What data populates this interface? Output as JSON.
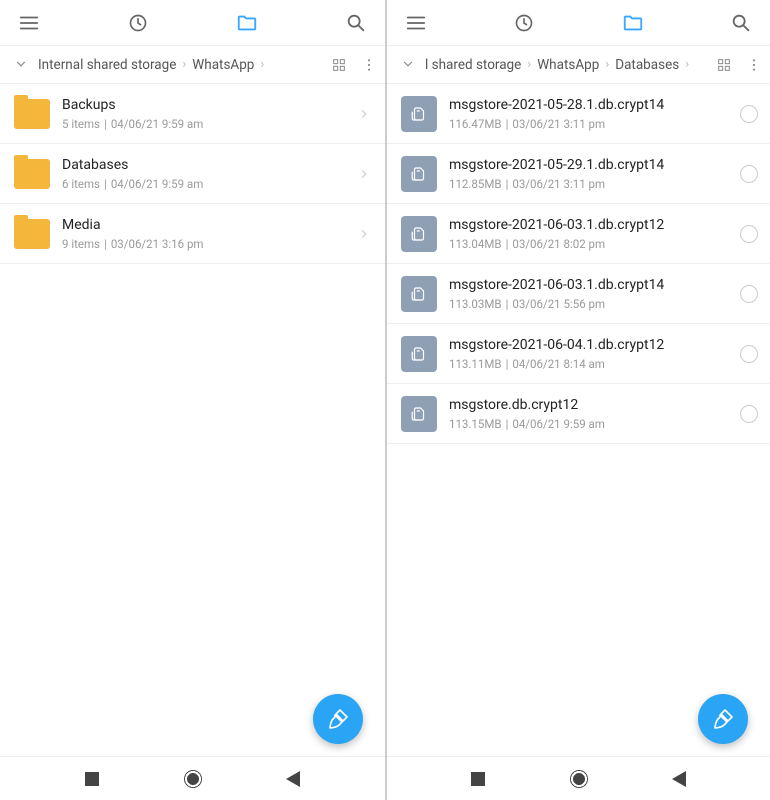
{
  "panes": [
    {
      "breadcrumb": [
        "Internal shared storage",
        "WhatsApp"
      ],
      "rows": [
        {
          "kind": "folder",
          "name": "Backups",
          "meta1": "5 items",
          "meta2": "04/06/21 9:59 am"
        },
        {
          "kind": "folder",
          "name": "Databases",
          "meta1": "6 items",
          "meta2": "04/06/21 9:59 am"
        },
        {
          "kind": "folder",
          "name": "Media",
          "meta1": "9 items",
          "meta2": "03/06/21 3:16 pm"
        }
      ]
    },
    {
      "breadcrumb": [
        "l shared storage",
        "WhatsApp",
        "Databases"
      ],
      "rows": [
        {
          "kind": "file",
          "name": "msgstore-2021-05-28.1.db.crypt14",
          "meta1": "116.47MB",
          "meta2": "03/06/21 3:11 pm"
        },
        {
          "kind": "file",
          "name": "msgstore-2021-05-29.1.db.crypt14",
          "meta1": "112.85MB",
          "meta2": "03/06/21 3:11 pm"
        },
        {
          "kind": "file",
          "name": "msgstore-2021-06-03.1.db.crypt12",
          "meta1": "113.04MB",
          "meta2": "03/06/21 8:02 pm"
        },
        {
          "kind": "file",
          "name": "msgstore-2021-06-03.1.db.crypt14",
          "meta1": "113.03MB",
          "meta2": "03/06/21 5:56 pm"
        },
        {
          "kind": "file",
          "name": "msgstore-2021-06-04.1.db.crypt12",
          "meta1": "113.11MB",
          "meta2": "04/06/21 8:14 am"
        },
        {
          "kind": "file",
          "name": "msgstore.db.crypt12",
          "meta1": "113.15MB",
          "meta2": "04/06/21 9:59 am"
        }
      ]
    }
  ]
}
